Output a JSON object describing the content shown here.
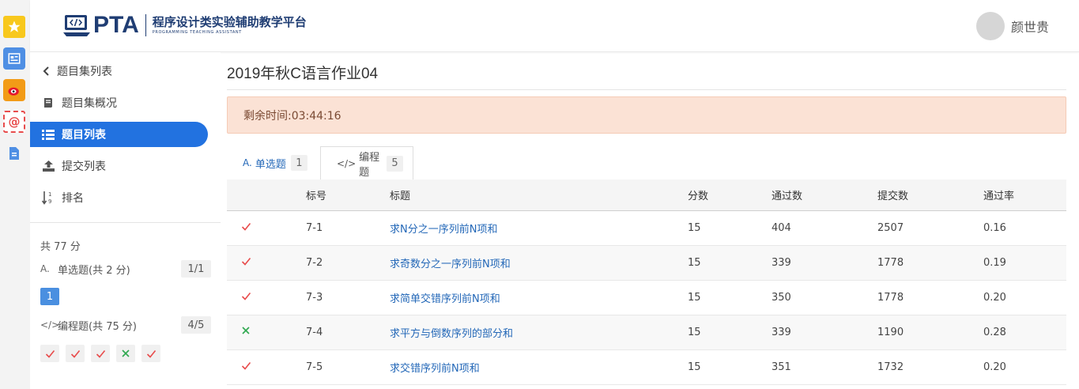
{
  "dock": {
    "items": [
      {
        "icon": "star-icon"
      },
      {
        "icon": "news-icon"
      },
      {
        "icon": "weibo-icon"
      },
      {
        "icon": "mail-icon",
        "glyph": "@"
      },
      {
        "icon": "document-icon"
      }
    ]
  },
  "header": {
    "logo_text": "PTA",
    "logo_subtitle": "程序设计类实验辅助教学平台",
    "logo_subtitle_en": "PROGRAMMING TEACHING ASSISTANT",
    "username": "颜世贵"
  },
  "sidebar": {
    "back_label": "题目集列表",
    "items": [
      {
        "label": "题目集概况",
        "icon": "book-icon"
      },
      {
        "label": "题目列表",
        "icon": "list-icon",
        "active": true
      },
      {
        "label": "提交列表",
        "icon": "upload-icon"
      },
      {
        "label": "排名",
        "icon": "sort-icon"
      }
    ],
    "total_score": "共 77 分",
    "categories": [
      {
        "icon_text": "A.",
        "label": "单选题(共 2 分)",
        "count": "1/1",
        "problems": [
          "1"
        ]
      },
      {
        "icon_text": "</>",
        "label": "编程题(共 75 分)",
        "count": "4/5",
        "results": [
          "pass",
          "pass",
          "pass",
          "fail",
          "pass"
        ]
      }
    ]
  },
  "main": {
    "title": "2019年秋C语言作业04",
    "timer_text": "剩余时间:03:44:16",
    "tabs": [
      {
        "icon_text": "A.",
        "label": "单选题",
        "count": "1",
        "active": false
      },
      {
        "icon_text": "</>",
        "label": "编程题",
        "count": "5",
        "active": true
      }
    ],
    "table": {
      "headers": [
        "",
        "标号",
        "标题",
        "分数",
        "通过数",
        "提交数",
        "通过率"
      ],
      "rows": [
        {
          "status": "pass",
          "id": "7-1",
          "title": "求N分之一序列前N项和",
          "score": "15",
          "passed": "404",
          "submitted": "2507",
          "rate": "0.16"
        },
        {
          "status": "pass",
          "id": "7-2",
          "title": "求奇数分之一序列前N项和",
          "score": "15",
          "passed": "339",
          "submitted": "1778",
          "rate": "0.19"
        },
        {
          "status": "pass",
          "id": "7-3",
          "title": "求简单交错序列前N项和",
          "score": "15",
          "passed": "350",
          "submitted": "1778",
          "rate": "0.20"
        },
        {
          "status": "fail",
          "id": "7-4",
          "title": "求平方与倒数序列的部分和",
          "score": "15",
          "passed": "339",
          "submitted": "1190",
          "rate": "0.28"
        },
        {
          "status": "pass",
          "id": "7-5",
          "title": "求交错序列前N项和",
          "score": "15",
          "passed": "351",
          "submitted": "1732",
          "rate": "0.20"
        }
      ]
    }
  },
  "colors": {
    "accent": "#2272e0",
    "link": "#2468b8",
    "pass": "#e84c4c",
    "fail": "#2fa84f",
    "timer_bg": "#fbe2d5"
  }
}
